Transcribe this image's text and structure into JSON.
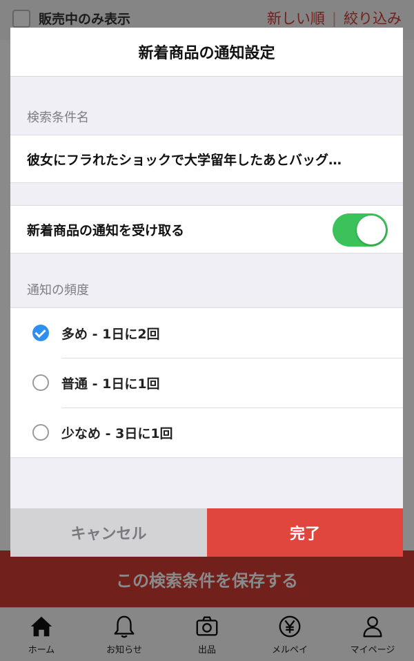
{
  "background": {
    "on_sale_only_label": "販売中のみ表示",
    "sort_label": "新しい順",
    "filter_label": "絞り込み",
    "save_search_label": "この検索条件を保存する"
  },
  "modal": {
    "title": "新着商品の通知設定",
    "search_name_header": "検索条件名",
    "search_name_value": "彼女にフラれたショックで大学留年したあとバッグ…",
    "notify_toggle_label": "新着商品の通知を受け取る",
    "notify_toggle_on": true,
    "frequency_header": "通知の頻度",
    "frequency_options": [
      {
        "label": "多め - 1日に2回",
        "selected": true
      },
      {
        "label": "普通 - 1日に1回",
        "selected": false
      },
      {
        "label": "少なめ - 3日に1回",
        "selected": false
      }
    ],
    "cancel_label": "キャンセル",
    "done_label": "完了"
  },
  "tabbar": {
    "items": [
      {
        "label": "ホーム",
        "icon": "home-icon"
      },
      {
        "label": "お知らせ",
        "icon": "bell-icon"
      },
      {
        "label": "出品",
        "icon": "camera-icon"
      },
      {
        "label": "メルペイ",
        "icon": "yen-icon"
      },
      {
        "label": "マイページ",
        "icon": "person-icon"
      }
    ]
  },
  "colors": {
    "brand_red": "#d23b34",
    "done_red": "#e0463e",
    "toggle_green": "#3cc25a",
    "radio_blue": "#2f8ff0"
  }
}
